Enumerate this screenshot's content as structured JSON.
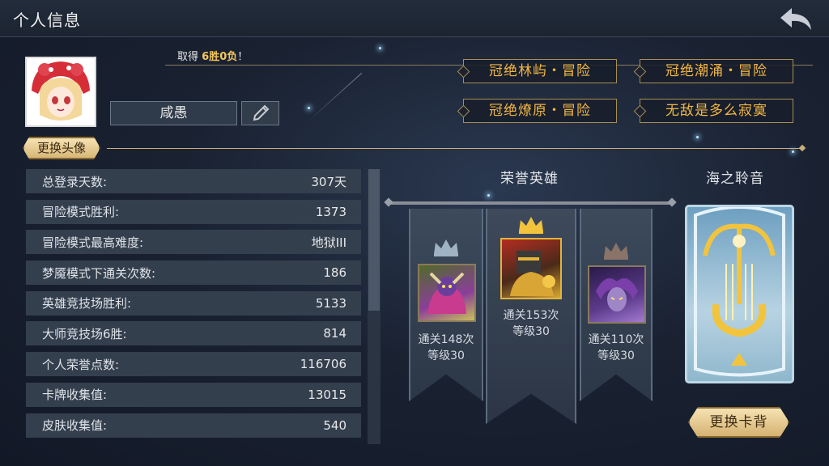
{
  "header": {
    "title": "个人信息"
  },
  "profile": {
    "record_prefix": "取得",
    "record_value": "6胜0负",
    "record_suffix": "！",
    "name": "咸愚",
    "change_avatar_label": "更换头像"
  },
  "titles": [
    "冠绝林屿・冒险",
    "冠绝潮涌・冒险",
    "冠绝燎原・冒险",
    "无敌是多么寂寞"
  ],
  "stats": [
    {
      "label": "总登录天数:",
      "value": "307天"
    },
    {
      "label": "冒险模式胜利:",
      "value": "1373"
    },
    {
      "label": "冒险模式最高难度:",
      "value": "地狱III"
    },
    {
      "label": "梦魇模式下通关次数:",
      "value": "186"
    },
    {
      "label": "英雄竞技场胜利:",
      "value": "5133"
    },
    {
      "label": "大师竞技场6胜:",
      "value": "814"
    },
    {
      "label": "个人荣誉点数:",
      "value": "116706"
    },
    {
      "label": "卡牌收集值:",
      "value": "13015"
    },
    {
      "label": "皮肤收集值:",
      "value": "540"
    }
  ],
  "heroes": {
    "section_title": "荣誉英雄",
    "items": [
      {
        "clears": "通关148次",
        "level": "等级30"
      },
      {
        "clears": "通关153次",
        "level": "等级30"
      },
      {
        "clears": "通关110次",
        "level": "等级30"
      }
    ]
  },
  "card_back": {
    "section_title": "海之聆音",
    "change_label": "更换卡背"
  },
  "colors": {
    "gold": "#f3b743",
    "silver_crown": "#9fb3c4",
    "gold_crown": "#f2c43d",
    "bronze_crown": "#8a7368"
  },
  "icons": {
    "back": "back-arrow-icon",
    "edit": "pencil-icon"
  }
}
